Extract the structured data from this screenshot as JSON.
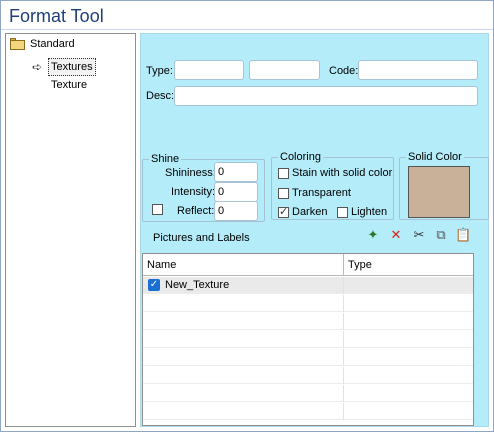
{
  "window": {
    "title": "Format Tool"
  },
  "tree": {
    "items": [
      {
        "label": "Standard",
        "icon": "folder-open-icon"
      },
      {
        "label": "Textures",
        "icon": "arrow-right-icon",
        "selected": true
      },
      {
        "label": "Texture"
      }
    ]
  },
  "form": {
    "type_label": "Type:",
    "type_value_1": "",
    "type_value_2": "",
    "code_label": "Code:",
    "code_value": "",
    "desc_label": "Desc:",
    "desc_value": ""
  },
  "shine": {
    "title": "Shine",
    "shininess_label": "Shininess:",
    "shininess_value": "0",
    "intensity_label": "Intensity:",
    "intensity_value": "0",
    "reflect_label": "Reflect:",
    "reflect_value": "0",
    "reflect_checked": false
  },
  "coloring": {
    "title": "Coloring",
    "stain_label": "Stain with solid color",
    "stain_checked": false,
    "transparent_label": "Transparent",
    "transparent_checked": false,
    "darken_label": "Darken",
    "darken_checked": true,
    "lighten_label": "Lighten",
    "lighten_checked": false
  },
  "solid_color": {
    "title": "Solid Color",
    "color": "#c8b099"
  },
  "pictures": {
    "title": "Pictures and Labels",
    "toolbar_icons": [
      "new-icon",
      "delete-icon",
      "cut-icon",
      "copy-icon",
      "paste-icon"
    ],
    "columns": [
      "Name",
      "Type"
    ],
    "rows": [
      {
        "name": "New_Texture",
        "type": "",
        "checked": true
      }
    ]
  },
  "colors": {
    "panel_bg": "#b4ecfa",
    "title_text": "#1f3f78",
    "delete_red": "#d9261c",
    "checkbox_blue": "#1a6fd3"
  }
}
